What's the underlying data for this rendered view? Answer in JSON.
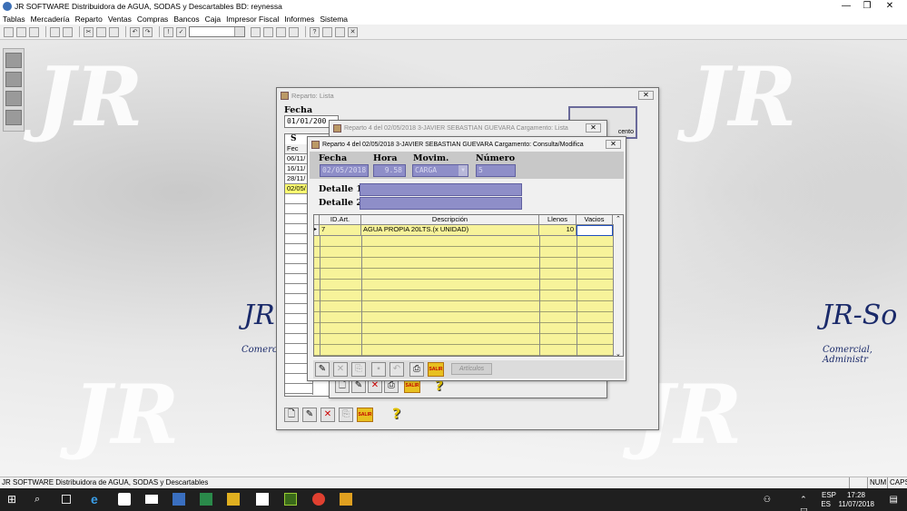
{
  "app": {
    "title": "JR SOFTWARE Distribuidora de AGUA, SODAS y Descartables BD: reynessa"
  },
  "menu": [
    "Tablas",
    "Mercadería",
    "Reparto",
    "Ventas",
    "Compras",
    "Bancos",
    "Caja",
    "Impresor Fiscal",
    "Informes",
    "Sistema"
  ],
  "brand": {
    "left": "JR",
    "left_sub": "Comercia",
    "right": "JR-So",
    "right_sub": "Comercial, Administr"
  },
  "reparto_lista": {
    "title": "Reparto: Lista",
    "fecha_label": "Fecha",
    "fecha_value": "01/01/200",
    "col_s": "S",
    "col_fec": "Fec",
    "rows": [
      "06/11/",
      "16/11/",
      "28/11/",
      "02/05/"
    ],
    "side_button": "cento"
  },
  "cargamento_lista": {
    "title": "Reparto 4 del 02/05/2018 3-JAVIER SEBASTIAN GUEVARA Cargamento: Lista"
  },
  "cargamento_modifica": {
    "title": "Reparto 4 del 02/05/2018 3-JAVIER SEBASTIAN GUEVARA Cargamento:  Consulta/Modifica",
    "fecha_label": "Fecha",
    "hora_label": "Hora",
    "movim_label": "Movim.",
    "numero_label": "Número",
    "fecha_value": "02/05/2018",
    "hora_value": "9.58",
    "movim_value": "CARGA",
    "numero_value": "5",
    "detalle1_label": "Detalle 1",
    "detalle2_label": "Detalle 2",
    "grid": {
      "headers": [
        "ID.Art.",
        "Descripción",
        "Llenos",
        "Vacios"
      ],
      "rows": [
        {
          "id": "7",
          "descripcion": "AGUA PROPIA 20LTS.(x UNIDAD)",
          "llenos": "10",
          "vacios": ""
        }
      ]
    },
    "articulos_button": "Artículos",
    "salir_label": "SALIR"
  },
  "statusbar": {
    "text": "JR SOFTWARE Distribuidora de AGUA, SODAS y Descartables",
    "num": "NUM",
    "caps": "CAPS"
  },
  "taskbar": {
    "lang_top": "ESP",
    "lang_bottom": "ES",
    "time": "17:28",
    "date": "11/07/2018"
  },
  "colors": {
    "grid_yellow": "#f7f39a",
    "field_blue": "#8e8ec8",
    "brand_navy": "#1a2a6a"
  }
}
